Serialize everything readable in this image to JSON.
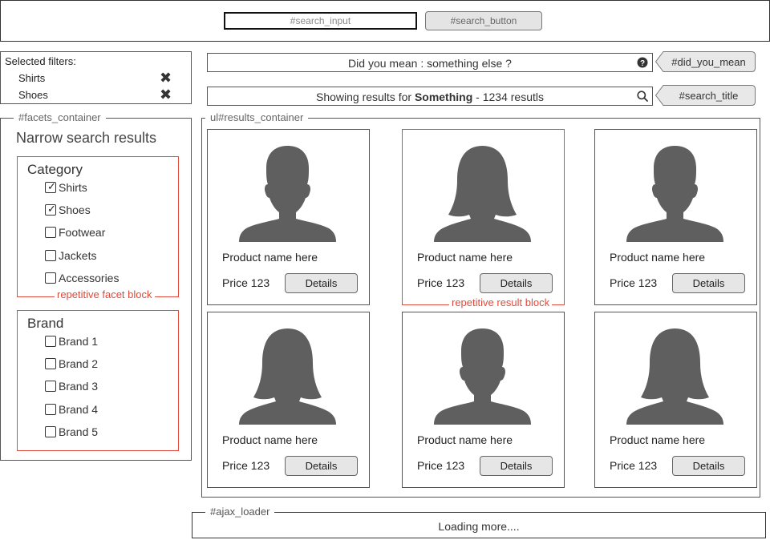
{
  "header": {
    "search_placeholder": "#search_input",
    "search_button": "#search_button"
  },
  "selected_filters": {
    "title": "Selected filters:",
    "items": [
      {
        "label": "Shirts",
        "remove_icon": "close-x-icon"
      },
      {
        "label": "Shoes",
        "remove_icon": "close-x-icon"
      }
    ]
  },
  "facets": {
    "container_label": "#facets_container",
    "heading": "Narrow search results",
    "blocks": [
      {
        "title": "Category",
        "options": [
          {
            "label": "Shirts",
            "checked": true
          },
          {
            "label": "Shoes",
            "checked": true
          },
          {
            "label": "Footwear",
            "checked": false
          },
          {
            "label": "Jackets",
            "checked": false
          },
          {
            "label": "Accessories",
            "checked": false
          }
        ],
        "caption": "repetitive facet block"
      },
      {
        "title": "Brand",
        "options": [
          {
            "label": "Brand 1",
            "checked": false
          },
          {
            "label": "Brand 2",
            "checked": false
          },
          {
            "label": "Brand 3",
            "checked": false
          },
          {
            "label": "Brand 4",
            "checked": false
          },
          {
            "label": "Brand 5",
            "checked": false
          }
        ]
      }
    ]
  },
  "did_you_mean": {
    "text": "Did you mean : something else ?",
    "icon": "question-circle-icon",
    "callout": "#did_you_mean"
  },
  "search_title": {
    "prefix": "Showing results for ",
    "term": "Something",
    "suffix": " - 1234 resutls",
    "icon": "search-icon",
    "callout": "#search_title"
  },
  "results": {
    "container_label": "ul#results_container",
    "block_caption": "repetitive result block",
    "items": [
      {
        "avatar": "male-silhouette-icon",
        "name": "Product name here",
        "price": "Price 123",
        "button": "Details"
      },
      {
        "avatar": "female-silhouette-icon",
        "name": "Product name here",
        "price": "Price 123",
        "button": "Details"
      },
      {
        "avatar": "male-silhouette-icon",
        "name": "Product name here",
        "price": "Price 123",
        "button": "Details"
      },
      {
        "avatar": "female-silhouette-icon",
        "name": "Product name here",
        "price": "Price 123",
        "button": "Details"
      },
      {
        "avatar": "male-silhouette-icon",
        "name": "Product name here",
        "price": "Price 123",
        "button": "Details"
      },
      {
        "avatar": "female-silhouette-icon",
        "name": "Product name here",
        "price": "Price 123",
        "button": "Details"
      }
    ]
  },
  "ajax_loader": {
    "label": "#ajax_loader",
    "text": "Loading more...."
  },
  "colors": {
    "accent_red": "#e04a3a",
    "silhouette": "#5f5f5f",
    "button_bg": "#e6e6e6"
  }
}
